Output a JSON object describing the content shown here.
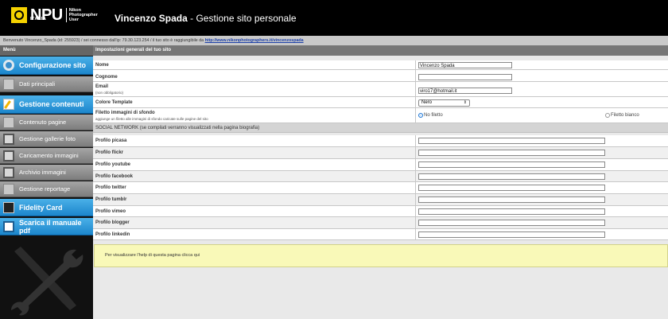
{
  "header": {
    "logo_text": "NPU",
    "logo_sub_line1": "Nikon",
    "logo_sub_line2": "Photographer",
    "logo_sub_line3": "User",
    "logo_country": "ITALIA",
    "title_bold": "Vincenzo Spada",
    "title_rest": " - Gestione sito personale"
  },
  "welcome": {
    "text": "Benvenuto Vincenzo_Spada (id: 255923) / sei connesso dall'ip: 79.30.123.254 / il tuo sito è raggiungibile da ",
    "link": "http://www.nikonphotographers.it/vincenzospada"
  },
  "sidebar": {
    "header": "Menù",
    "items": [
      {
        "label": "Configurazione sito",
        "icon": "gear-icon",
        "style": "blue"
      },
      {
        "label": "Dati principali",
        "icon": "tools-icon",
        "style": "gray"
      },
      {
        "label": "Gestione contenuti",
        "icon": "pencil-icon",
        "style": "blue"
      },
      {
        "label": "Contenuto pagine",
        "icon": "document-icon",
        "style": "gray"
      },
      {
        "label": "Gestione gallerie foto",
        "icon": "gallery-icon",
        "style": "gray"
      },
      {
        "label": "Caricamento immagini",
        "icon": "upload-icon",
        "style": "gray"
      },
      {
        "label": "Archivio immagini",
        "icon": "archive-icon",
        "style": "gray"
      },
      {
        "label": "Gestione reportage",
        "icon": "reportage-icon",
        "style": "gray"
      },
      {
        "label": "Fidelity Card",
        "icon": "card-icon",
        "style": "blue"
      },
      {
        "label": "Scarica il manuale pdf",
        "icon": "book-icon",
        "style": "blue"
      }
    ]
  },
  "main": {
    "section_title": "Impostazioni generali del tuo sito",
    "fields": {
      "nome_label": "Nome",
      "nome_value": "Vincenzo Spada",
      "cognome_label": "Cognome",
      "cognome_value": "",
      "email_label": "Email",
      "email_note": "(non obbligatorio)",
      "email_value": "viro17@hotmail.it",
      "colore_label": "Colore Template",
      "colore_value": "Nero",
      "filetto_label": "Filetto immagini di sfondo",
      "filetto_note": "aggiunge un filetto alle immagini di sfondo caricate sulle pagine del sito",
      "filetto_option1": "No filetto",
      "filetto_option2": "Filetto bianco"
    },
    "social_header": "SOCIAL NETWORK (se compilati verranno visualizzati nella pagina biografia)",
    "social": [
      {
        "label": "Profilo picasa",
        "value": ""
      },
      {
        "label": "Profilo flickr",
        "value": ""
      },
      {
        "label": "Profilo youtube",
        "value": ""
      },
      {
        "label": "Profilo facebook",
        "value": ""
      },
      {
        "label": "Profilo twitter",
        "value": ""
      },
      {
        "label": "Profilo tumblr",
        "value": ""
      },
      {
        "label": "Profilo vimeo",
        "value": ""
      },
      {
        "label": "Profilo blogger",
        "value": ""
      },
      {
        "label": "Profilo linkedin",
        "value": ""
      }
    ],
    "help_text": "Per visualizzare l'help di questa pagina clicca qui"
  }
}
